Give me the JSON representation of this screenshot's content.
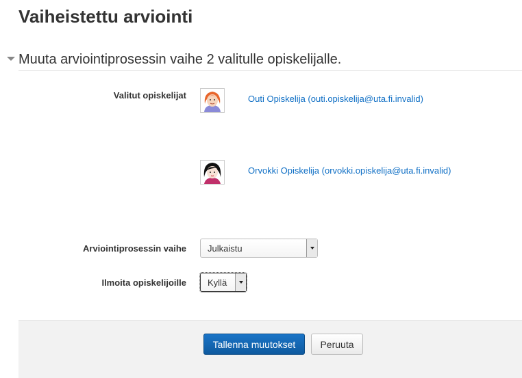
{
  "page": {
    "title": "Vaiheistettu arviointi"
  },
  "section": {
    "legend": "Muuta arviointiprosessin vaihe 2 valitulle opiskelijalle."
  },
  "form": {
    "selected_students_label": "Valitut opiskelijat",
    "students": [
      {
        "name": "Outi Opiskelija (outi.opiskelija@uta.fi.invalid)",
        "avatar": "avatar-girl-red-hair"
      },
      {
        "name": "Orvokki Opiskelija (orvokki.opiskelija@uta.fi.invalid)",
        "avatar": "avatar-girl-black-hair"
      }
    ],
    "workflow_state_label": "Arviointiprosessin vaihe",
    "workflow_state_value": "Julkaistu",
    "notify_label": "Ilmoita opiskelijoille",
    "notify_value": "Kyllä"
  },
  "buttons": {
    "save": "Tallenna muutokset",
    "cancel": "Peruuta"
  },
  "colors": {
    "link": "#0f6fc5",
    "primary": "#1a74c7",
    "footer_bg": "#f2f2f2"
  }
}
